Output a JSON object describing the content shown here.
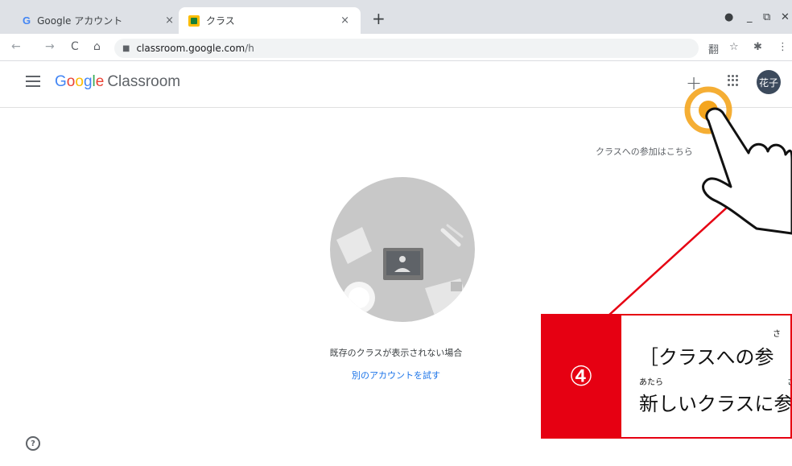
{
  "browser": {
    "tabs": [
      {
        "favicon": "google-g-icon",
        "title": "Google アカウント",
        "close": "×",
        "active": false
      },
      {
        "favicon": "classroom-icon",
        "title": "クラス",
        "close": "×",
        "active": true
      }
    ],
    "new_tab": "+",
    "window_controls": {
      "minimize": "_",
      "restore": "⧉",
      "close": "✕"
    },
    "profile_icon": "●",
    "nav": {
      "back": "←",
      "forward": "→",
      "reload": "C",
      "home": "⌂"
    },
    "url": {
      "host": "classroom.google.com",
      "path": "/h"
    },
    "toolbar_icons": {
      "translate": "翻",
      "star": "☆",
      "extensions": "✱",
      "menu": "⋮"
    }
  },
  "app": {
    "logo": {
      "google": [
        "G",
        "o",
        "o",
        "g",
        "l",
        "e"
      ],
      "product": "Classroom"
    },
    "header": {
      "plus": "+",
      "avatar": "花子"
    },
    "join_hint": "クラスへの参加はこちら",
    "empty_state": {
      "message": "既存のクラスが表示されない場合",
      "link": "別のアカウントを試す"
    },
    "help": "?"
  },
  "annotation": {
    "step_number": "④",
    "line1": "［クラスへの参",
    "line2": "新しいクラスに参",
    "ruby1": "さ",
    "ruby2": "あたら",
    "ruby3": "さ"
  },
  "colors": {
    "accent_red": "#e60012",
    "highlight_orange": "#f4a51e",
    "link_blue": "#1a73e8"
  }
}
